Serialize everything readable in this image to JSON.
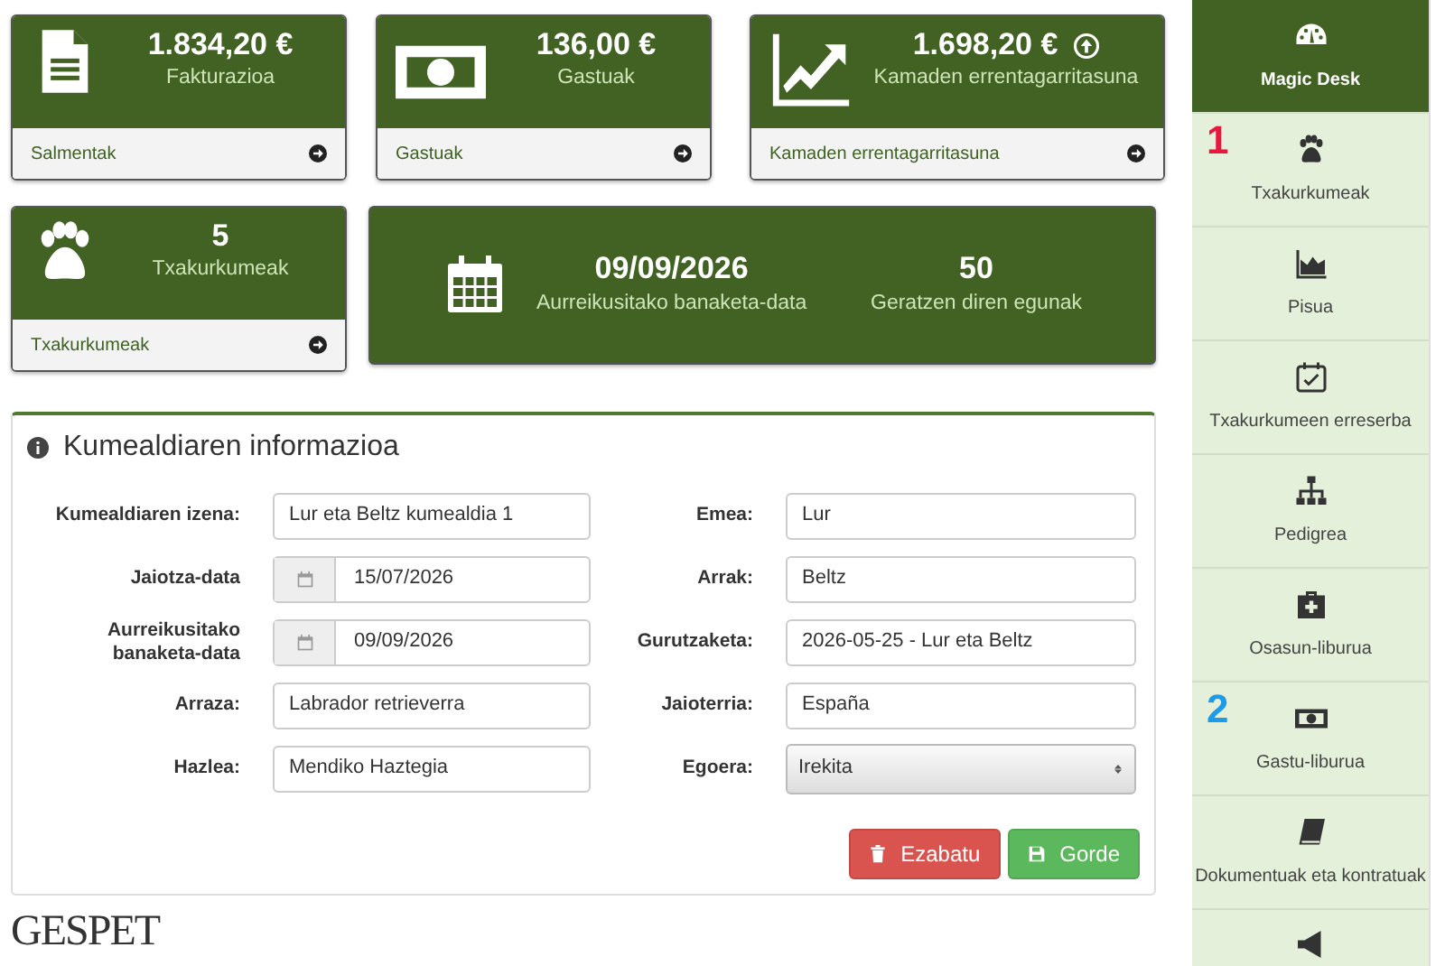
{
  "stat_cards": [
    {
      "kind": "link",
      "value": "1.834,20 €",
      "label": "Fakturazioa",
      "footer": "Salmentak",
      "trend_up": false
    },
    {
      "kind": "link",
      "value": "136,00 €",
      "label": "Gastuak",
      "footer": "Gastuak",
      "trend_up": false
    },
    {
      "kind": "link",
      "value": "1.698,20 €",
      "label": "Kamaden errentagarritasuna",
      "footer": "Kamaden errentagarritasuna",
      "trend_up": true
    },
    {
      "kind": "link",
      "value": "5",
      "label": "Txakurkumeak",
      "footer": "Txakurkumeak",
      "trend_up": false
    }
  ],
  "date_card": {
    "date": "09/09/2026",
    "date_label": "Aurreikusitako banaketa-data",
    "days": "50",
    "days_label": "Geratzen diren egunak"
  },
  "panel": {
    "title": "Kumealdiaren informazioa",
    "left_fields": [
      {
        "kind": "text",
        "label": "Kumealdiaren izena:",
        "value": "Lur eta Beltz kumealdia 1"
      },
      {
        "kind": "date",
        "label": "Jaiotza-data",
        "value": "15/07/2026"
      },
      {
        "kind": "date",
        "label": "Aurreikusitako banaketa-data",
        "value": "09/09/2026"
      },
      {
        "kind": "text",
        "label": "Arraza:",
        "value": "Labrador retrieverra"
      },
      {
        "kind": "text",
        "label": "Hazlea:",
        "value": "Mendiko Haztegia"
      }
    ],
    "right_fields": [
      {
        "kind": "text",
        "label": "Emea:",
        "value": "Lur"
      },
      {
        "kind": "text",
        "label": "Arrak:",
        "value": "Beltz"
      },
      {
        "kind": "text",
        "label": "Gurutzaketa:",
        "value": "2026-05-25 - Lur eta Beltz"
      },
      {
        "kind": "text",
        "label": "Jaioterria:",
        "value": "España"
      },
      {
        "kind": "select",
        "label": "Egoera:",
        "value": "Irekita"
      }
    ],
    "buttons": [
      {
        "kind": "delete",
        "label": "Ezabatu"
      },
      {
        "kind": "save",
        "label": "Gorde"
      }
    ]
  },
  "logo": "GESPET",
  "sidebar": {
    "items": [
      {
        "label": "Magic Desk",
        "selected": true
      },
      {
        "label": "Txakurkumeak",
        "selected": false,
        "marker": "1",
        "color": "#e8173f"
      },
      {
        "label": "Pisua",
        "selected": false
      },
      {
        "label": "Txakurkumeen erreserba",
        "selected": false
      },
      {
        "label": "Pedigrea",
        "selected": false
      },
      {
        "label": "Osasun-liburua",
        "selected": false
      },
      {
        "label": "Gastu-liburua",
        "selected": false,
        "marker": "2",
        "color": "#1e9be8"
      },
      {
        "label": "Dokumentuak eta kontratuak",
        "selected": false
      },
      {
        "selected": false
      }
    ]
  }
}
